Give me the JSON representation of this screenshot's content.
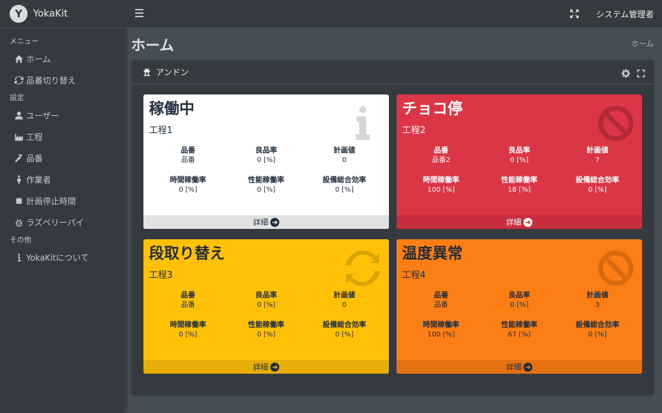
{
  "brand": {
    "logo_letter": "Y",
    "name": "YokaKit"
  },
  "sidebar": {
    "sections": [
      {
        "header": "メニュー",
        "items": [
          {
            "label": "ホーム",
            "icon": "home-icon"
          },
          {
            "label": "品番切り替え",
            "icon": "sync-icon"
          }
        ]
      },
      {
        "header": "設定",
        "items": [
          {
            "label": "ユーザー",
            "icon": "user-icon"
          },
          {
            "label": "工程",
            "icon": "industry-icon"
          },
          {
            "label": "品番",
            "icon": "hammer-icon"
          },
          {
            "label": "作業者",
            "icon": "worker-icon"
          },
          {
            "label": "計画停止時間",
            "icon": "stop-icon"
          },
          {
            "label": "ラズベリーパイ",
            "icon": "raspberry-icon"
          }
        ]
      },
      {
        "header": "その他",
        "items": [
          {
            "label": "YokaKitについて",
            "icon": "info-icon"
          }
        ]
      }
    ]
  },
  "topbar": {
    "user": "システム管理者",
    "expand_icon": "expand-icon",
    "menu_icon": "hamburger-icon"
  },
  "content": {
    "title": "ホーム",
    "breadcrumb": "ホーム"
  },
  "card": {
    "title": "アンドン",
    "icon": "andon-icon",
    "tools": [
      "gear-icon",
      "fullscreen-icon"
    ]
  },
  "boxes": [
    {
      "state": "稼働中",
      "process": "工程1",
      "theme": "white",
      "icon": "info-icon",
      "metrics": [
        {
          "label": "品番",
          "value": "品番"
        },
        {
          "label": "良品率",
          "value": "0 [%]"
        },
        {
          "label": "計画値",
          "value": "0"
        },
        {
          "label": "時間稼働率",
          "value": "0 [%]"
        },
        {
          "label": "性能稼働率",
          "value": "0 [%]"
        },
        {
          "label": "設備総合効率",
          "value": "0 [%]"
        }
      ],
      "footer": "詳細"
    },
    {
      "state": "チョコ停",
      "process": "工程2",
      "theme": "red",
      "icon": "ban-icon",
      "metrics": [
        {
          "label": "品番",
          "value": "品番2"
        },
        {
          "label": "良品率",
          "value": "0 [%]"
        },
        {
          "label": "計画値",
          "value": "7"
        },
        {
          "label": "時間稼働率",
          "value": "100 [%]"
        },
        {
          "label": "性能稼働率",
          "value": "18 [%]"
        },
        {
          "label": "設備総合効率",
          "value": "0 [%]"
        }
      ],
      "footer": "詳細"
    },
    {
      "state": "段取り替え",
      "process": "工程3",
      "theme": "yellow",
      "icon": "sync-icon",
      "metrics": [
        {
          "label": "品番",
          "value": "品番"
        },
        {
          "label": "良品率",
          "value": "0 [%]"
        },
        {
          "label": "計画値",
          "value": "0"
        },
        {
          "label": "時間稼働率",
          "value": "0 [%]"
        },
        {
          "label": "性能稼働率",
          "value": "0 [%]"
        },
        {
          "label": "設備総合効率",
          "value": "0 [%]"
        }
      ],
      "footer": "詳細"
    },
    {
      "state": "温度異常",
      "process": "工程4",
      "theme": "orange",
      "icon": "ban-icon",
      "metrics": [
        {
          "label": "品番",
          "value": "品番"
        },
        {
          "label": "良品率",
          "value": "0 [%]"
        },
        {
          "label": "計画値",
          "value": "3"
        },
        {
          "label": "時間稼働率",
          "value": "100 [%]"
        },
        {
          "label": "性能稼働率",
          "value": "67 [%]"
        },
        {
          "label": "設備総合効率",
          "value": "0 [%]"
        }
      ],
      "footer": "詳細"
    }
  ]
}
